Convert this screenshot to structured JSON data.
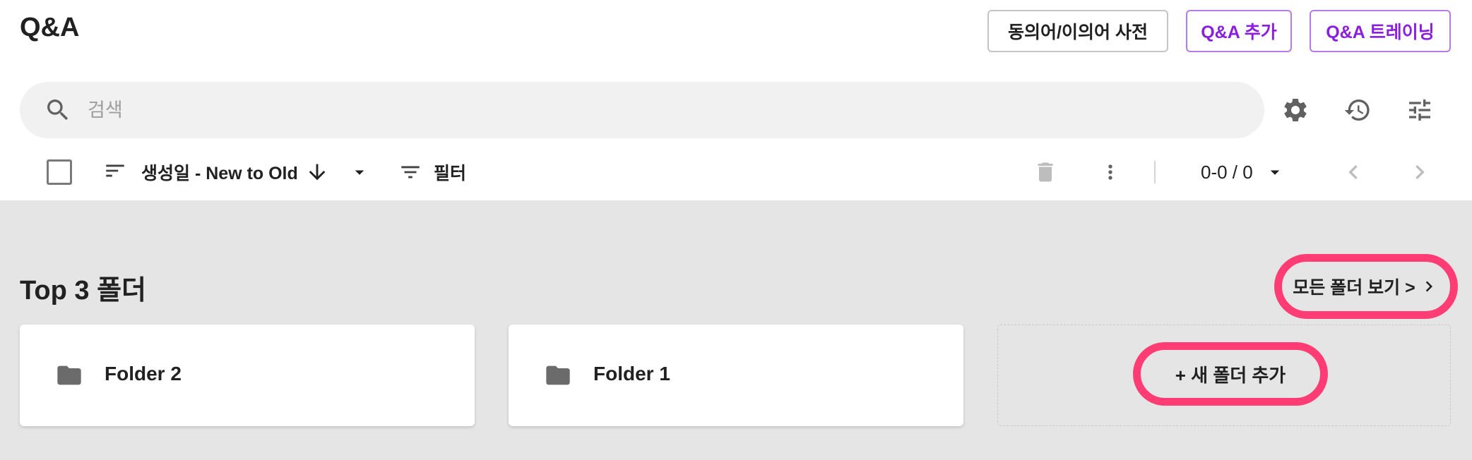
{
  "header": {
    "title": "Q&A",
    "buttons": {
      "dictionary": "동의어/이의어 사전",
      "add_qa": "Q&A 추가",
      "training": "Q&A 트레이닝"
    }
  },
  "search": {
    "placeholder": "검색",
    "value": ""
  },
  "toolbar": {
    "sort_label": "생성일 - New to Old",
    "filter_label": "필터",
    "pagination": "0-0 / 0"
  },
  "top_folders": {
    "title": "Top 3 폴더",
    "view_all_label": "모든 폴더 보기 >",
    "folders": [
      {
        "name": "Folder 2"
      },
      {
        "name": "Folder 1"
      }
    ],
    "add_folder_label": "+ 새 폴더 추가"
  },
  "colors": {
    "accent_purple": "#8a1fe0",
    "highlight_pink": "#ff3d74",
    "content_bg": "#e5e5e5",
    "search_bg": "#f1f1f1"
  },
  "icons": [
    "search-icon",
    "gear-icon",
    "history-icon",
    "tune-icon",
    "sort-icon",
    "arrow-down-icon",
    "caret-down-icon",
    "filter-icon",
    "trash-icon",
    "more-vert-icon",
    "chevron-left-icon",
    "chevron-right-icon",
    "folder-icon"
  ]
}
